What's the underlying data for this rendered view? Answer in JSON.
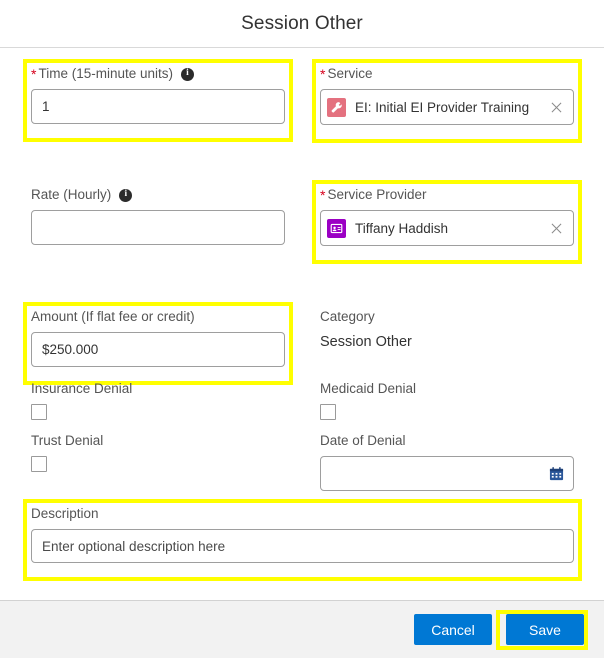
{
  "dialog": {
    "title": "Session Other"
  },
  "fields": {
    "time": {
      "label": "Time (15-minute units)",
      "required": true,
      "info_icon": "info-icon",
      "value": "1",
      "highlighted": true
    },
    "service": {
      "label": "Service",
      "required": true,
      "token_icon": "wrench-icon",
      "token_icon_color": "#e4717f",
      "value": "EI: Initial EI Provider Training",
      "remove_icon": "close-icon",
      "highlighted": true
    },
    "rate": {
      "label": "Rate (Hourly)",
      "required": false,
      "info_icon": "info-icon",
      "value": "",
      "highlighted": false
    },
    "service_provider": {
      "label": "Service Provider",
      "required": true,
      "token_icon": "contact-card-icon",
      "token_icon_color": "#9b00c4",
      "value": "Tiffany Haddish",
      "remove_icon": "close-icon",
      "highlighted": true
    },
    "amount": {
      "label": "Amount (If flat fee or credit)",
      "required": false,
      "value": "$250.000",
      "highlighted": true
    },
    "category": {
      "label": "Category",
      "value": "Session Other"
    },
    "insurance_denial": {
      "label": "Insurance Denial",
      "checked": false
    },
    "medicaid_denial": {
      "label": "Medicaid Denial",
      "checked": false
    },
    "trust_denial": {
      "label": "Trust Denial",
      "checked": false
    },
    "date_of_denial": {
      "label": "Date of Denial",
      "value": "",
      "calendar_icon": "calendar-icon",
      "calendar_icon_color": "#2b579a"
    },
    "description": {
      "label": "Description",
      "placeholder": "Enter optional description here",
      "value": "",
      "highlighted": true
    }
  },
  "footer": {
    "cancel_label": "Cancel",
    "save_label": "Save",
    "button_color": "#0078d4",
    "save_highlighted": true
  },
  "annotation": {
    "highlight_color": "#ffff00"
  }
}
